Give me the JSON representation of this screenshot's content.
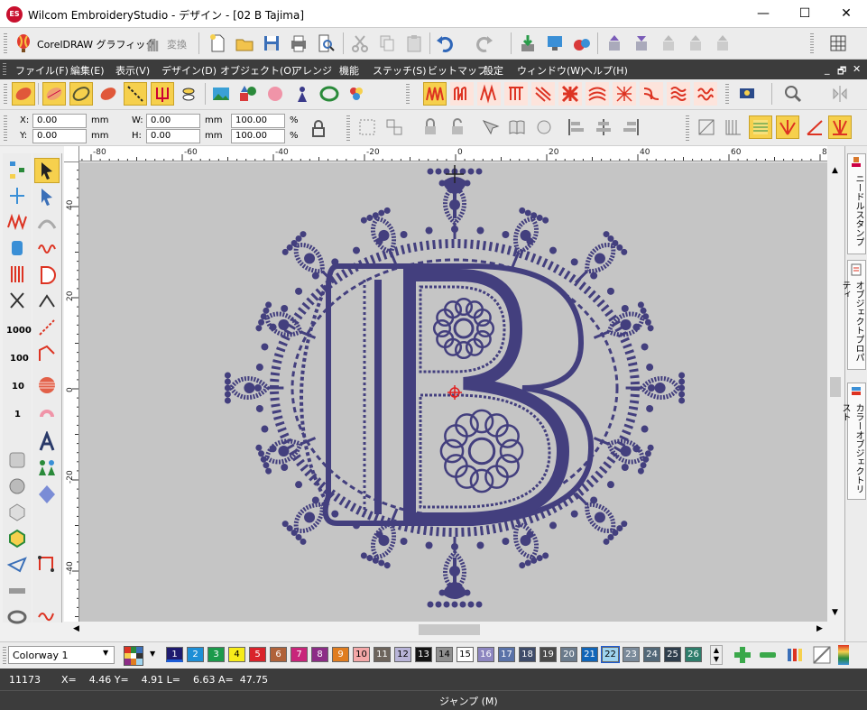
{
  "window": {
    "title": "Wilcom EmbroideryStudio - デザイン - [02  B          Tajima]",
    "logo": "ES",
    "minimize": "—",
    "maximize": "☐",
    "close": "✕"
  },
  "toolbar": {
    "coreldraw_label": "CorelDRAW グラフィック",
    "convert_label": "変換"
  },
  "menu": {
    "items": [
      "ファイル(F)",
      "編集(E)",
      "表示(V)",
      "デザイン(D)",
      "オブジェクト(O)",
      "アレンジ",
      "機能",
      "ステッチ(S)",
      "ビットマップ",
      "設定",
      "ウィンドウ(W)",
      "ヘルプ(H)"
    ],
    "mdi_controls": [
      "_",
      "🗗",
      "✕"
    ]
  },
  "property_bar": {
    "x_label": "X:",
    "x_value": "0.00",
    "y_label": "Y:",
    "y_value": "0.00",
    "w_label": "W:",
    "w_value": "0.00",
    "h_label": "H:",
    "h_value": "0.00",
    "unit": "mm",
    "scale_w": "100.00",
    "scale_h": "100.00",
    "percent": "%"
  },
  "ruler": {
    "top_labels": [
      "-80",
      "-60",
      "-40",
      "-20",
      "0",
      "20",
      "40",
      "60",
      "80"
    ],
    "left_labels": [
      "40",
      "20",
      "0",
      "-20",
      "-40"
    ]
  },
  "left_toolbar": {
    "stitch_values": [
      "1000",
      "100",
      "10",
      "1"
    ]
  },
  "docker": {
    "tabs": [
      "ニードルスタンプ",
      "オブジェクトプロパティ",
      "カラーオブジェクトリスト"
    ]
  },
  "palette": {
    "colorway": "Colorway 1",
    "swatches": [
      {
        "n": "1",
        "c": "#1e1a6e",
        "t": "#fff"
      },
      {
        "n": "2",
        "c": "#1e8fd6",
        "t": "#fff"
      },
      {
        "n": "3",
        "c": "#1b9a4b",
        "t": "#fff"
      },
      {
        "n": "4",
        "c": "#f7ec1a",
        "t": "#000"
      },
      {
        "n": "5",
        "c": "#d9232b",
        "t": "#fff"
      },
      {
        "n": "6",
        "c": "#b0623a",
        "t": "#fff"
      },
      {
        "n": "7",
        "c": "#c8257a",
        "t": "#fff"
      },
      {
        "n": "8",
        "c": "#8c2c86",
        "t": "#fff"
      },
      {
        "n": "9",
        "c": "#e07d20",
        "t": "#fff"
      },
      {
        "n": "10",
        "c": "#f4a8a8",
        "t": "#000"
      },
      {
        "n": "11",
        "c": "#6d645c",
        "t": "#fff"
      },
      {
        "n": "12",
        "c": "#b8b4d8",
        "t": "#000"
      },
      {
        "n": "13",
        "c": "#141414",
        "t": "#fff"
      },
      {
        "n": "14",
        "c": "#8f8f8f",
        "t": "#000"
      },
      {
        "n": "15",
        "c": "#ffffff",
        "t": "#000"
      },
      {
        "n": "16",
        "c": "#8d86c0",
        "t": "#fff"
      },
      {
        "n": "17",
        "c": "#5a72a8",
        "t": "#fff"
      },
      {
        "n": "18",
        "c": "#3f4c6a",
        "t": "#fff"
      },
      {
        "n": "19",
        "c": "#4a4a4a",
        "t": "#fff"
      },
      {
        "n": "20",
        "c": "#6b7b8c",
        "t": "#fff"
      },
      {
        "n": "21",
        "c": "#1065b8",
        "t": "#fff"
      },
      {
        "n": "22",
        "c": "#9fd4ef",
        "t": "#000"
      },
      {
        "n": "23",
        "c": "#7a8a9a",
        "t": "#fff"
      },
      {
        "n": "24",
        "c": "#526878",
        "t": "#fff"
      },
      {
        "n": "25",
        "c": "#2f3e4c",
        "t": "#fff"
      },
      {
        "n": "26",
        "c": "#2e7d6b",
        "t": "#fff"
      }
    ]
  },
  "status": {
    "stitch_count": "11173",
    "coords": "X=    4.46 Y=    4.91 L=    6.63 A=  47.75",
    "prompt": "ジャンプ (M)"
  },
  "colors": {
    "thread": "#433f7e",
    "accent": "#f6d04d",
    "canvas": "#c5c5c5"
  }
}
